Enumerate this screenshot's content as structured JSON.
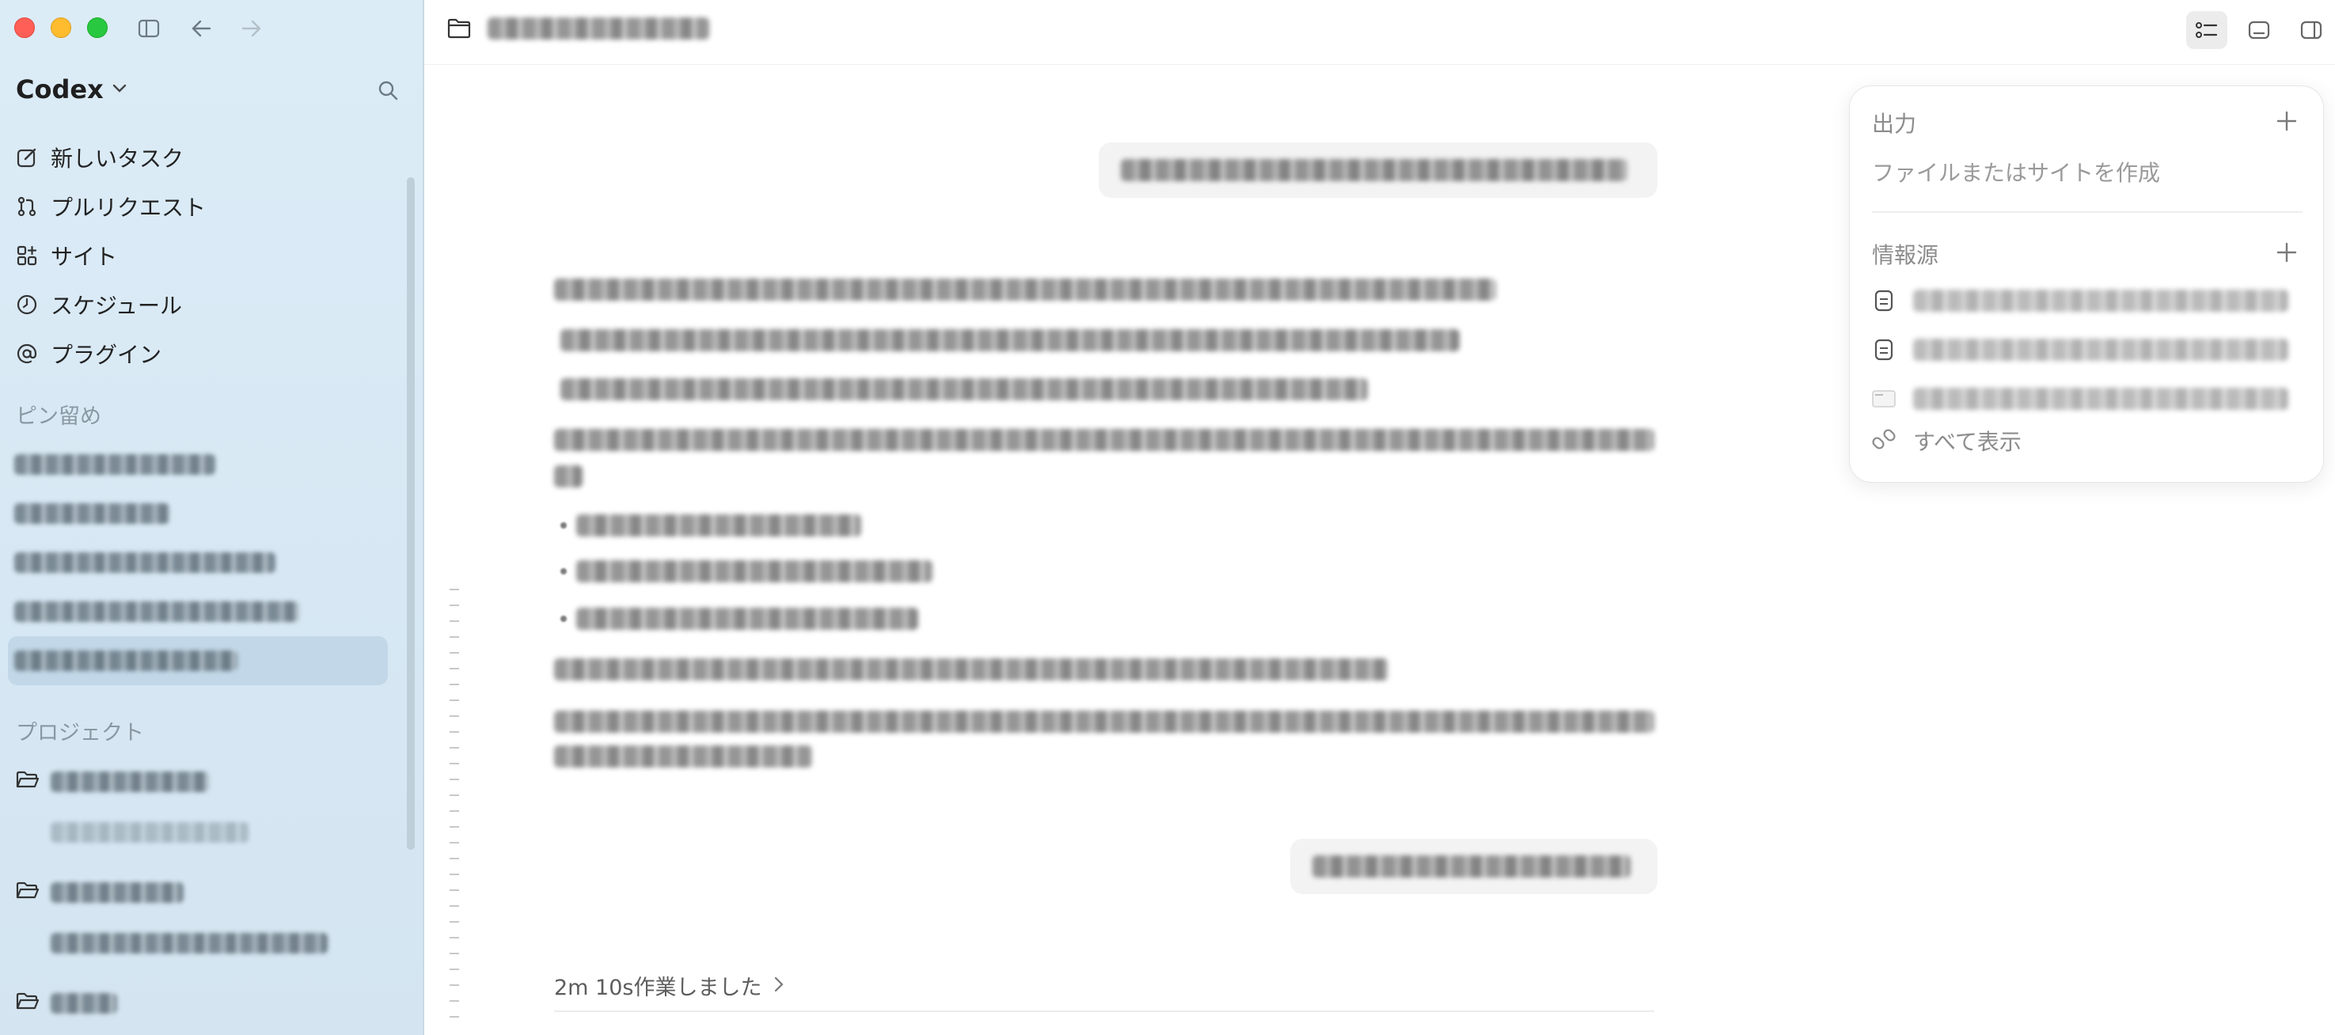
{
  "sidebar": {
    "brand": "Codex",
    "nav": [
      {
        "label": "新しいタスク",
        "icon": "compose-icon"
      },
      {
        "label": "プルリクエスト",
        "icon": "pull-request-icon"
      },
      {
        "label": "サイト",
        "icon": "grid-plus-icon"
      },
      {
        "label": "スケジュール",
        "icon": "clock-icon"
      },
      {
        "label": "プラグイン",
        "icon": "at-icon"
      }
    ],
    "pinned_title": "ピン留め",
    "projects_title": "プロジェクト"
  },
  "main": {
    "work_summary": "2m 10s作業しました"
  },
  "panel": {
    "output_title": "出力",
    "output_placeholder": "ファイルまたはサイトを作成",
    "sources_title": "情報源",
    "show_all": "すべて表示"
  },
  "colors": {
    "sidebar_bg": "#dcecf7",
    "close": "#ff5f57",
    "minimize": "#febc2e",
    "zoom": "#28c840"
  }
}
